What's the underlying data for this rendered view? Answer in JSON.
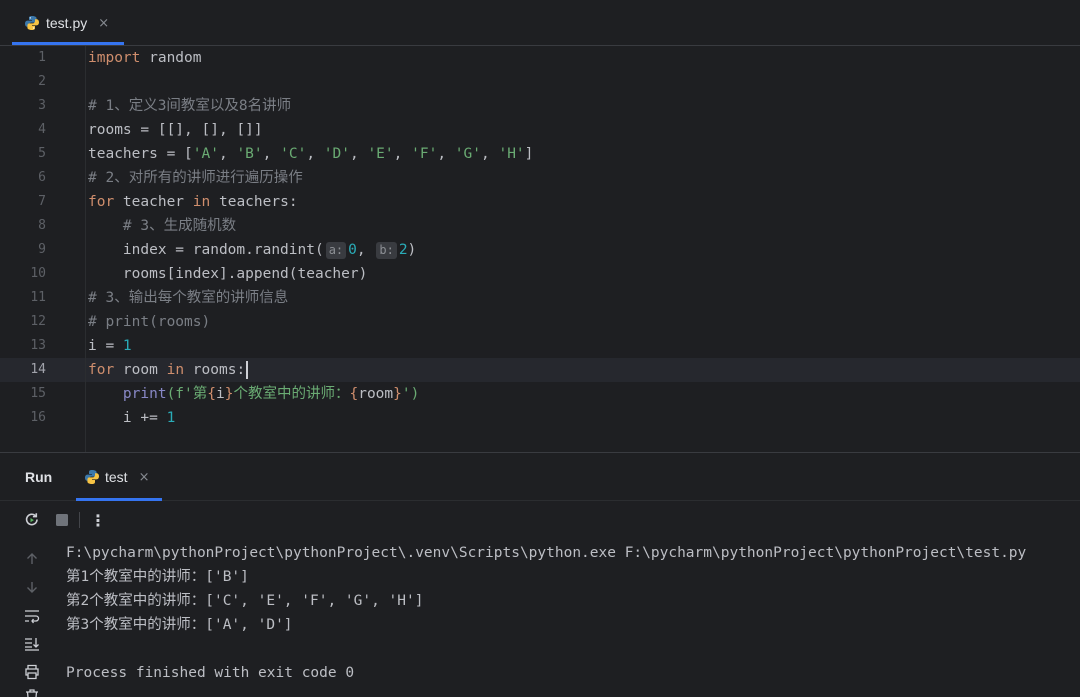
{
  "editor_tab": {
    "filename": "test.py",
    "close": "×"
  },
  "editor": {
    "line_numbers": [
      "1",
      "2",
      "3",
      "4",
      "5",
      "6",
      "7",
      "8",
      "9",
      "10",
      "11",
      "12",
      "13",
      "14",
      "15",
      "16"
    ],
    "current_line": "14",
    "code": {
      "l1": [
        "import",
        " random"
      ],
      "l3": "# 1、定义3间教室以及8名讲师",
      "l4": "rooms = [[], [], []]",
      "l5": [
        "teachers = [",
        "'A'",
        ", ",
        "'B'",
        ", ",
        "'C'",
        ", ",
        "'D'",
        ", ",
        "'E'",
        ", ",
        "'F'",
        ", ",
        "'G'",
        ", ",
        "'H'",
        "]"
      ],
      "l6": "# 2、对所有的讲师进行遍历操作",
      "l7": [
        "for",
        " teacher ",
        "in",
        " teachers:"
      ],
      "l8": "    # 3、生成随机数",
      "l9": [
        "    index = random.randint(",
        "a:",
        "0",
        ", ",
        "b:",
        "2",
        ")"
      ],
      "l10": "    rooms[index].append(teacher)",
      "l11": "# 3、输出每个教室的讲师信息",
      "l12": "# print(rooms)",
      "l13": [
        "i = ",
        "1"
      ],
      "l14": [
        "for",
        " room ",
        "in",
        " rooms:"
      ],
      "l15": [
        "    ",
        "print",
        "(f'第",
        "{",
        "i",
        "}",
        "个教室中的讲师：",
        "{",
        "room",
        "}",
        "')"
      ],
      "l16": [
        "    i += ",
        "1"
      ]
    }
  },
  "run_panel": {
    "title": "Run",
    "tab_label": "test",
    "tab_close": "×",
    "toolbar_more": "⋮",
    "output": [
      "F:\\pycharm\\pythonProject\\pythonProject\\.venv\\Scripts\\python.exe F:\\pycharm\\pythonProject\\pythonProject\\test.py",
      "第1个教室中的讲师：['B']",
      "第2个教室中的讲师：['C', 'E', 'F', 'G', 'H']",
      "第3个教室中的讲师：['A', 'D']",
      "",
      "Process finished with exit code 0"
    ]
  },
  "colors": {
    "background": "#1e1f22",
    "keyword": "#cf8e6d",
    "string": "#6aab73",
    "number": "#2aacb8",
    "comment": "#7a7e85",
    "accent": "#3574f0"
  },
  "icons": [
    "python-file-icon",
    "rerun-icon",
    "stop-icon",
    "more-options-icon",
    "scroll-up-icon",
    "scroll-down-icon",
    "soft-wrap-icon",
    "scroll-to-end-icon",
    "print-icon",
    "clear-icon"
  ]
}
